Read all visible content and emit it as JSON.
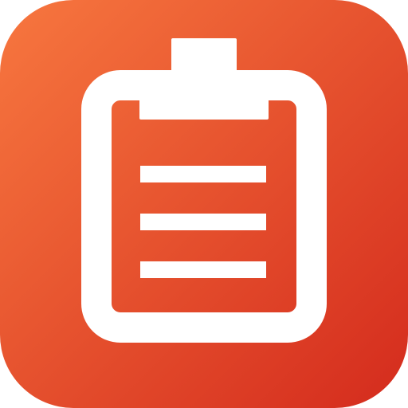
{
  "app_icon": {
    "name": "Clipboard",
    "glyph": "clipboard-icon",
    "colors": {
      "gradient_start": "#F7773F",
      "gradient_end": "#D42B1D",
      "foreground": "#FFFFFF"
    },
    "lines": [
      {
        "name": "line-1"
      },
      {
        "name": "line-2"
      },
      {
        "name": "line-3"
      }
    ]
  }
}
